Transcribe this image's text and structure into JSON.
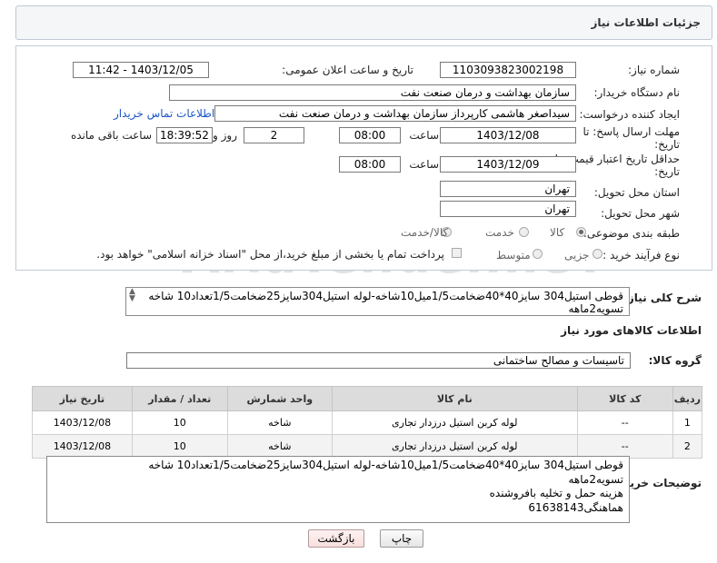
{
  "header": {
    "title": "جزئیات اطلاعات نیاز"
  },
  "form": {
    "need_number_label": "شماره نیاز:",
    "need_number": "1103093823002198",
    "announce_label": "تاریخ و ساعت اعلان عمومی:",
    "announce_value": "1403/12/05 - 11:42",
    "buyer_org_label": "نام دستگاه خریدار:",
    "buyer_org": "سازمان بهداشت و درمان صنعت نفت",
    "requester_label": "ایجاد کننده درخواست:",
    "requester": "سیداصغر هاشمی کارپرداز سازمان بهداشت و درمان صنعت نفت",
    "buyer_contact_link": "اطلاعات تماس خریدار",
    "deadline_label_1": "مهلت ارسال پاسخ: تا",
    "deadline_label_2": "تاریخ:",
    "deadline_date": "1403/12/08",
    "time_label": "ساعت",
    "deadline_time": "08:00",
    "days_value": "2",
    "days_label": "روز و",
    "remaining_time": "18:39:52",
    "remaining_label": "ساعت باقی مانده",
    "validity_label_1": "حداقل تاریخ اعتبار قیمت: تا",
    "validity_label_2": "تاریخ:",
    "validity_date": "1403/12/09",
    "validity_time_label": "ساعت",
    "validity_time": "08:00",
    "province_label": "استان محل تحویل:",
    "province": "تهران",
    "city_label": "شهر محل تحویل:",
    "city": "تهران",
    "category_label": "طبقه بندی موضوعی:",
    "category_options": [
      "کالا",
      "خدمت",
      "کالا/خدمت"
    ],
    "category_selected": "کالا",
    "process_label": "نوع فرآیند خرید :",
    "process_options": [
      "جزیی",
      "متوسط"
    ],
    "process_selected": "جزیی",
    "payment_note": "پرداخت تمام یا بخشی از مبلغ خرید،از محل \"اسناد خزانه اسلامی\" خواهد بود."
  },
  "description": {
    "label": "شرح کلی نیاز:",
    "text": "قوطی استیل304 سایز40*40ضخامت1/5میل10شاخه-لوله استیل304سایز25ضخامت1/5تعداد10 شاخه تسویه2ماهه"
  },
  "goods_section": {
    "title": "اطلاعات کالاهای مورد نیاز",
    "group_label": "گروه کالا:",
    "group_value": "تاسیسات و مصالح ساختمانی"
  },
  "table": {
    "headers": [
      "ردیف",
      "کد کالا",
      "نام کالا",
      "واحد شمارش",
      "تعداد / مقدار",
      "تاریخ نیاز"
    ],
    "rows": [
      [
        "1",
        "--",
        "لوله کربن استیل درزدار تجاری",
        "شاخه",
        "10",
        "1403/12/08"
      ],
      [
        "2",
        "--",
        "لوله کربن استیل درزدار تجاری",
        "شاخه",
        "10",
        "1403/12/08"
      ]
    ]
  },
  "buyer_notes": {
    "label": "توضیحات خریدار:",
    "lines": [
      "قوطی استیل304 سایز40*40ضخامت1/5میل10شاخه-لوله استیل304سایز25ضخامت1/5تعداد10 شاخه",
      "تسویه2ماهه",
      "هزینه حمل و تخلیه بافروشنده",
      "هماهنگی61638143"
    ]
  },
  "buttons": {
    "print": "چاپ",
    "back": "بازگشت"
  },
  "watermark": "AriaTender.neT"
}
